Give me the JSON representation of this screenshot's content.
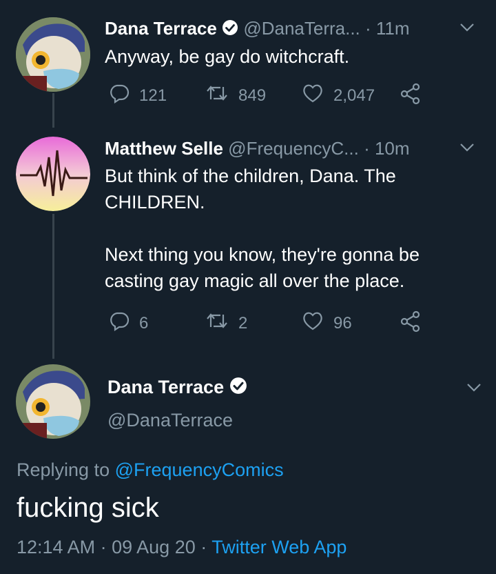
{
  "thread": [
    {
      "author": "Dana Terrace",
      "handle": "@DanaTerra...",
      "time": "· 11m",
      "text_lines": [
        "Anyway, be gay do witchcraft."
      ],
      "replies": "121",
      "retweets": "849",
      "likes": "2,047"
    },
    {
      "author": "Matthew Selle",
      "handle": "@FrequencyC...",
      "time": "· 10m",
      "text_lines": [
        "But think of the children, Dana. The",
        "CHILDREN.",
        "",
        "Next thing you know, they're gonna be",
        "casting gay magic all over the place."
      ],
      "replies": "6",
      "retweets": "2",
      "likes": "96"
    }
  ],
  "main_tweet": {
    "author": "Dana Terrace",
    "handle": "@DanaTerrace",
    "replying_prefix": "Replying to",
    "replying_to": "@FrequencyComics",
    "text": "fucking sick",
    "time": "12:14 AM",
    "sep1": "·",
    "date": "09 Aug 20",
    "sep2": "·",
    "source": "Twitter Web App"
  },
  "colors": {
    "background": "#15202b",
    "muted": "#8899a6",
    "link": "#1da1f2",
    "thread_line": "#38444d"
  },
  "icons": [
    "verified-icon",
    "chevron-down-icon",
    "reply-icon",
    "retweet-icon",
    "like-icon",
    "share-icon"
  ]
}
